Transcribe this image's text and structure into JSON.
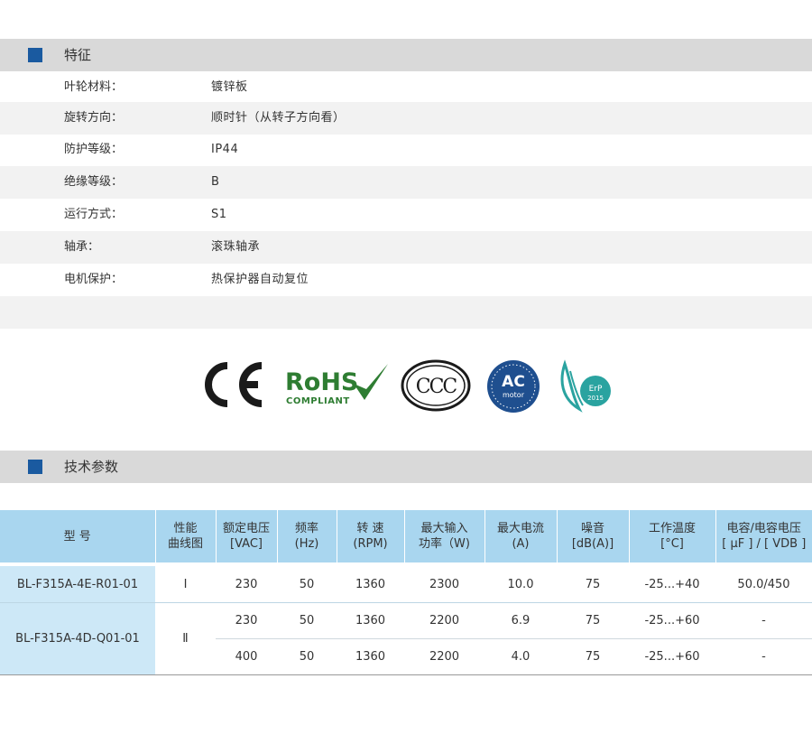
{
  "features": {
    "title": "特征",
    "rows": [
      {
        "key": "叶轮材料：",
        "value": "镀锌板"
      },
      {
        "key": "旋转方向：",
        "value": "顺时针（从转子方向看）"
      },
      {
        "key": "防护等级：",
        "value": "IP44"
      },
      {
        "key": "绝缘等级：",
        "value": "B"
      },
      {
        "key": "运行方式：",
        "value": "S1"
      },
      {
        "key": "轴承：",
        "value": "滚珠轴承"
      },
      {
        "key": "电机保护：",
        "value": "热保护器自动复位"
      }
    ]
  },
  "logos": {
    "ce": "CE",
    "rohs": "RoHS",
    "rohs_sub": "COMPLIANT",
    "ccc": "CCC",
    "ac_main": "AC",
    "ac_sub": "motor",
    "erp_main": "ErP",
    "erp_year": "2015"
  },
  "specs": {
    "title": "技术参数",
    "headers": [
      {
        "l1": "型 号",
        "l2": ""
      },
      {
        "l1": "性能",
        "l2": "曲线图"
      },
      {
        "l1": "额定电压",
        "l2": "[VAC]"
      },
      {
        "l1": "频率",
        "l2": "(Hz)"
      },
      {
        "l1": "转 速",
        "l2": "(RPM)"
      },
      {
        "l1": "最大输入",
        "l2": "功率（W)"
      },
      {
        "l1": "最大电流",
        "l2": "(A)"
      },
      {
        "l1": "噪音",
        "l2": "[dB(A)]"
      },
      {
        "l1": "工作温度",
        "l2": "[°C]"
      },
      {
        "l1": "电容/电容电压",
        "l2": "[ μF ] / [ VDB ]"
      }
    ],
    "rows": [
      {
        "model": "BL-F315A-4E-R01-01",
        "curve": "Ⅰ",
        "voltage": "230",
        "freq": "50",
        "rpm": "1360",
        "power": "2300",
        "current": "10.0",
        "noise": "75",
        "temp": "-25...+40",
        "cap": "50.0/450"
      },
      {
        "model": "BL-F315A-4D-Q01-01",
        "curve": "Ⅱ",
        "voltage": "230",
        "freq": "50",
        "rpm": "1360",
        "power": "2200",
        "current": "6.9",
        "noise": "75",
        "temp": "-25...+60",
        "cap": "-"
      },
      {
        "voltage": "400",
        "freq": "50",
        "rpm": "1360",
        "power": "2200",
        "current": "4.0",
        "noise": "75",
        "temp": "-25...+60",
        "cap": "-"
      }
    ]
  },
  "colors": {
    "section_bar": "#d9d9d9",
    "section_square": "#1a5aa0",
    "row_shade": "#f2f2f2",
    "table_header": "#a9d6ef",
    "model_cell": "#cde8f7"
  }
}
